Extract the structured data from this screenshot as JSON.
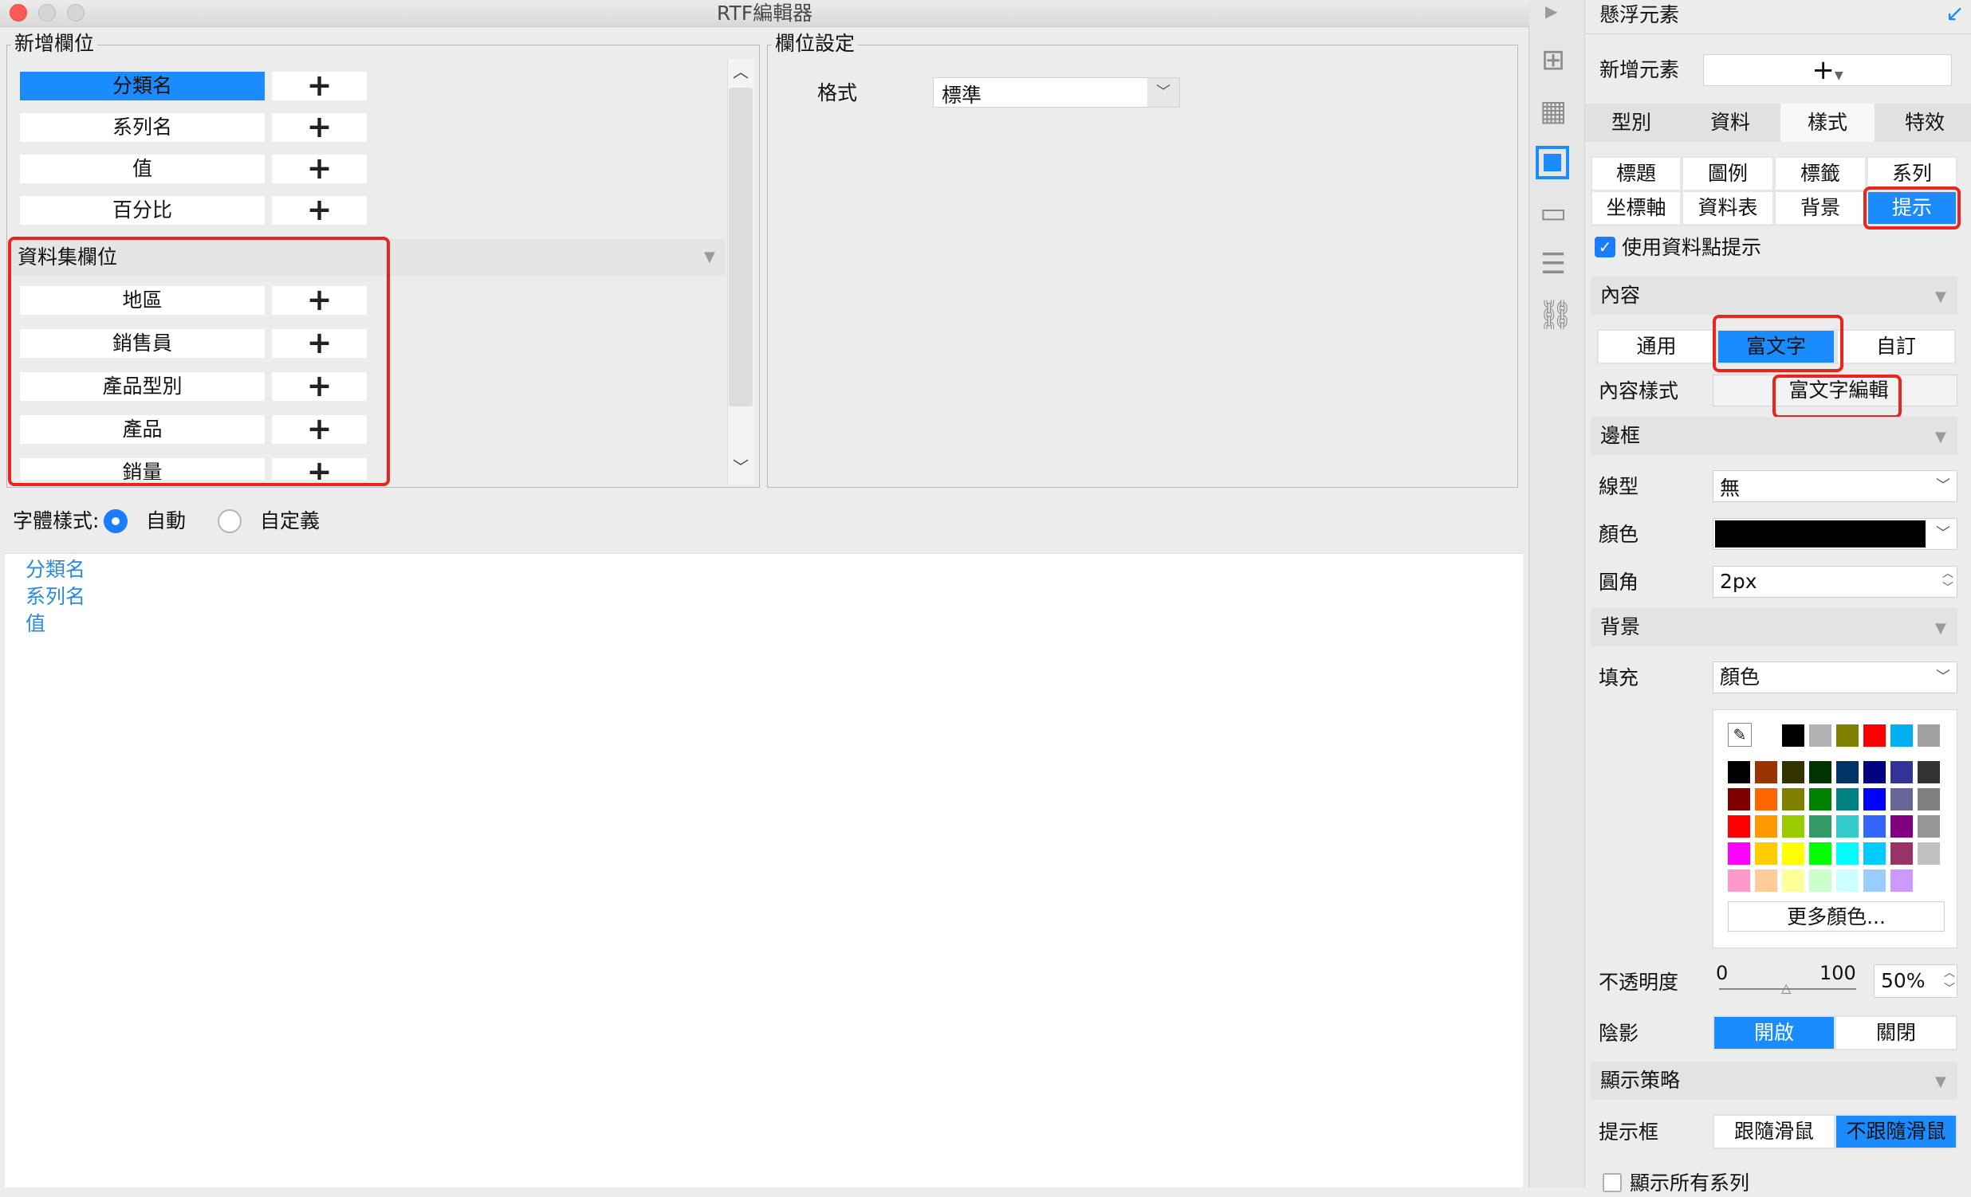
{
  "window": {
    "title": "RTF編輯器"
  },
  "add_fields": {
    "legend": "新增欄位",
    "items": [
      {
        "label": "分類名",
        "selected": true
      },
      {
        "label": "系列名",
        "selected": false
      },
      {
        "label": "值",
        "selected": false
      },
      {
        "label": "百分比",
        "selected": false
      }
    ],
    "dataset_category": "資料集欄位",
    "dataset_items": [
      "地區",
      "銷售員",
      "產品型別",
      "產品",
      "銷量"
    ],
    "plus_symbol": "+"
  },
  "field_settings": {
    "legend": "欄位設定",
    "format_label": "格式",
    "format_value": "標準"
  },
  "font_style": {
    "label": "字體樣式:",
    "options": [
      "自動",
      "自定義"
    ],
    "selected": "自動"
  },
  "editor": {
    "lines": [
      "分類名",
      "系列名",
      "值"
    ]
  },
  "panel": {
    "title": "懸浮元素",
    "add_element_label": "新增元素",
    "tabs": [
      "型別",
      "資料",
      "樣式",
      "特效"
    ],
    "active_tab": "樣式",
    "subtabs_row1": [
      "標題",
      "圖例",
      "標籤",
      "系列"
    ],
    "subtabs_row2": [
      "坐標軸",
      "資料表",
      "背景",
      "提示"
    ],
    "active_subtab": "提示",
    "use_tooltip_label": "使用資料點提示",
    "content_section": "內容",
    "content_modes": [
      "通用",
      "富文字",
      "自訂"
    ],
    "active_mode": "富文字",
    "content_style_label": "內容樣式",
    "rich_text_edit": "富文字編輯",
    "border_section": "邊框",
    "line_type_label": "線型",
    "line_type_value": "無",
    "color_label": "顏色",
    "radius_label": "圓角",
    "radius_value": "2px",
    "background_section": "背景",
    "fill_label": "填充",
    "fill_value": "顏色",
    "more_colors": "更多顏色...",
    "opacity_label": "不透明度",
    "opacity_min": "0",
    "opacity_max": "100",
    "opacity_value": "50%",
    "shadow_label": "陰影",
    "shadow_options": [
      "開啟",
      "關閉"
    ],
    "shadow_selected": "開啟",
    "display_section": "顯示策略",
    "tooltip_box_label": "提示框",
    "tooltip_box_options": [
      "跟隨滑鼠",
      "不跟隨滑鼠"
    ],
    "tooltip_box_selected": "不跟隨滑鼠",
    "show_all_series": "顯示所有系列"
  },
  "colors": {
    "accent": "#1a8cff",
    "highlight_red": "#e8261e",
    "recent": [
      "#000000",
      "#b2b2b2",
      "#808000",
      "#ff0000",
      "#00b0f0",
      "#a0a0a0"
    ],
    "palette": [
      [
        "#000000",
        "#993300",
        "#333300",
        "#003300",
        "#003366",
        "#000080",
        "#333399",
        "#333333"
      ],
      [
        "#800000",
        "#ff6600",
        "#808000",
        "#008000",
        "#008080",
        "#0000ff",
        "#666699",
        "#808080"
      ],
      [
        "#ff0000",
        "#ff9900",
        "#99cc00",
        "#339966",
        "#33cccc",
        "#3366ff",
        "#800080",
        "#969696"
      ],
      [
        "#ff00ff",
        "#ffcc00",
        "#ffff00",
        "#00ff00",
        "#00ffff",
        "#00ccff",
        "#993366",
        "#c0c0c0"
      ],
      [
        "#ff99cc",
        "#ffcc99",
        "#ffff99",
        "#ccffcc",
        "#ccffff",
        "#99ccff",
        "#cc99ff",
        "#ffffff"
      ]
    ]
  }
}
